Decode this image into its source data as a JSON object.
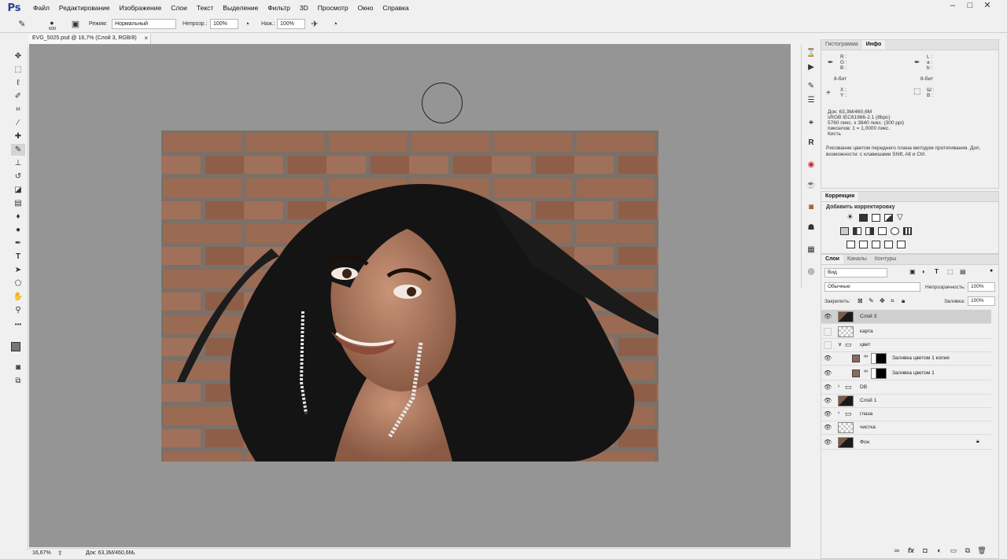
{
  "app": {
    "logo": "Ps"
  },
  "menu": [
    "Файл",
    "Редактирование",
    "Изображение",
    "Слои",
    "Текст",
    "Выделение",
    "Фильтр",
    "3D",
    "Просмотр",
    "Окно",
    "Справка"
  ],
  "options": {
    "brush_size": "600",
    "mode_label": "Режим:",
    "mode_value": "Нормальный",
    "opacity_label": "Непрозр.:",
    "opacity_value": "100%",
    "flow_label": "Наж.:",
    "flow_value": "100%"
  },
  "document": {
    "tab_title": "EVG_5025.psd @ 16,7% (Слой 3, RGB/8)"
  },
  "status": {
    "zoom": "16,67%",
    "doc_size": "Док: 63,3M/460,6M"
  },
  "info_panel": {
    "tabs": [
      "Гистограмма",
      "Инфо"
    ],
    "active_tab": "Инфо",
    "rgb_labels": [
      "R :",
      "G :",
      "B :"
    ],
    "lab_labels": [
      "L :",
      "a :",
      "b :"
    ],
    "bit_left": "8-бит",
    "bit_right": "8-бит",
    "xy_labels": [
      "X :",
      "Y :"
    ],
    "wh_labels": [
      "Ш :",
      "В :"
    ],
    "doc_info": [
      "Док: 63,3M/460,6M",
      "sRGB IEC61966-2.1 (8bpc)",
      "5760 пикс. x 3840 пикс. (300 ppi)",
      "пикселов: 1 = 1,0000 пикс.",
      "Кисть"
    ],
    "hint_line1": "Рисование цветом переднего плана методом протягивания. Доп.",
    "hint_line2": "возможности: с клавишами Shift, Alt и Ctrl."
  },
  "adjustments": {
    "title": "Коррекция",
    "subtitle": "Добавить корректировку"
  },
  "layers_panel": {
    "tabs": [
      "Слои",
      "Каналы",
      "Контуры"
    ],
    "active_tab": "Слои",
    "filter_kind": "Вид",
    "blend_mode": "Обычные",
    "opacity_label": "Непрозрачность:",
    "opacity_value": "100%",
    "lock_label": "Закрепить:",
    "fill_label": "Заливка:",
    "fill_value": "100%",
    "layers": [
      {
        "name": "Слой 3",
        "visible": true,
        "selected": true,
        "thumb": "photo"
      },
      {
        "name": "карта",
        "visible": false,
        "selected": false,
        "thumb": "checker"
      },
      {
        "name": "цвет",
        "visible": false,
        "selected": false,
        "thumb": "group"
      },
      {
        "name": "Заливка цветом 1 копия",
        "visible": true,
        "selected": false,
        "thumb": "fill"
      },
      {
        "name": "Заливка цветом 1",
        "visible": true,
        "selected": false,
        "thumb": "fill"
      },
      {
        "name": "DB",
        "visible": true,
        "selected": false,
        "thumb": "group"
      },
      {
        "name": "Слой 1",
        "visible": true,
        "selected": false,
        "thumb": "photo"
      },
      {
        "name": "глаза",
        "visible": true,
        "selected": false,
        "thumb": "group"
      },
      {
        "name": "чистка",
        "visible": true,
        "selected": false,
        "thumb": "checker"
      },
      {
        "name": "Фон",
        "visible": true,
        "selected": false,
        "thumb": "photo"
      }
    ]
  }
}
